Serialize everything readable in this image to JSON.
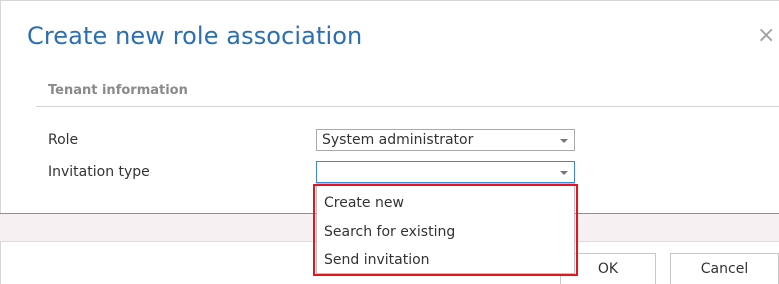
{
  "dialog": {
    "title": "Create new role association",
    "close_glyph": "×",
    "close_icon_name": "close-icon"
  },
  "section": {
    "title": "Tenant information"
  },
  "fields": {
    "role": {
      "label": "Role",
      "value": "System administrator"
    },
    "invitation_type": {
      "label": "Invitation type",
      "value": "",
      "options": [
        "Create new",
        "Search for existing",
        "Send invitation"
      ]
    }
  },
  "buttons": {
    "ok": "OK",
    "cancel": "Cancel"
  },
  "colors": {
    "title": "#2a6fb4",
    "highlight": "#e8141b",
    "footer_rule": "#5b9bd5",
    "footer_band": "#f7f0f2"
  }
}
